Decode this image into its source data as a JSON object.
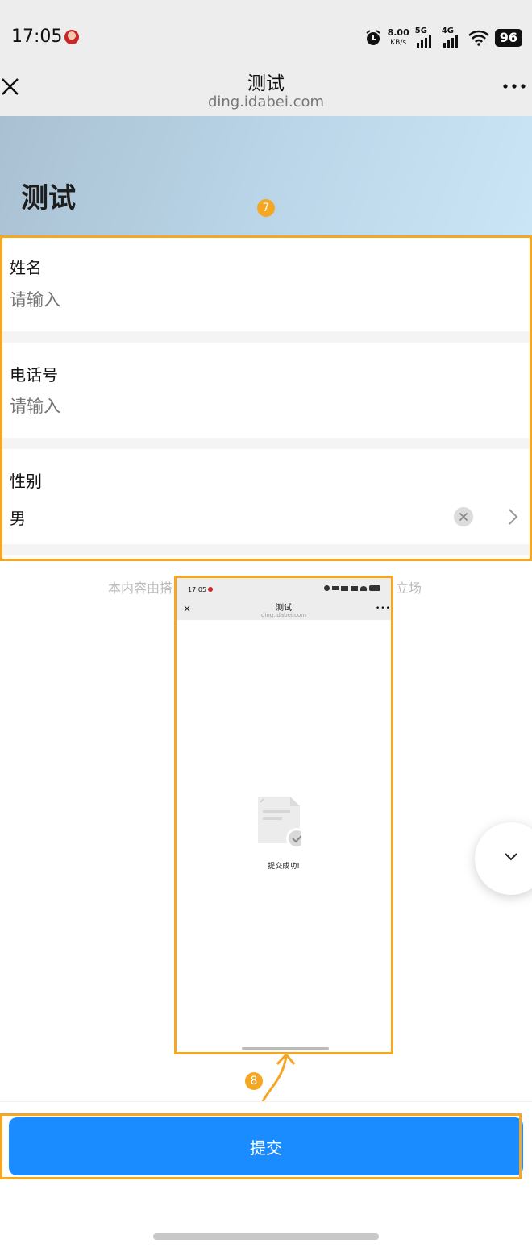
{
  "status_bar": {
    "time": "17:05",
    "network_speed_value": "8.00",
    "network_speed_unit": "KB/s",
    "signal_1_label": "5G",
    "signal_2_label": "4G",
    "battery": "96"
  },
  "nav": {
    "title": "测试",
    "subtitle": "ding.idabei.com",
    "close_icon": "close-icon",
    "more_icon": "more-icon"
  },
  "banner": {
    "title": "测试"
  },
  "annotations": {
    "marker_1": "7",
    "marker_2": "8",
    "color": "#f5a623"
  },
  "form": {
    "fields": [
      {
        "label": "姓名",
        "placeholder": "请输入",
        "value": ""
      },
      {
        "label": "电话号",
        "placeholder": "请输入",
        "value": ""
      },
      {
        "label": "性别",
        "value": "男"
      }
    ]
  },
  "footnote": {
    "start": "本内容由搭",
    "end": "立场"
  },
  "inset": {
    "time": "17:05",
    "title": "测试",
    "subtitle": "ding.idabei.com",
    "close": "×",
    "more": "•••",
    "success_text": "提交成功!"
  },
  "submit": {
    "label": "提交",
    "color": "#1a8cff"
  }
}
